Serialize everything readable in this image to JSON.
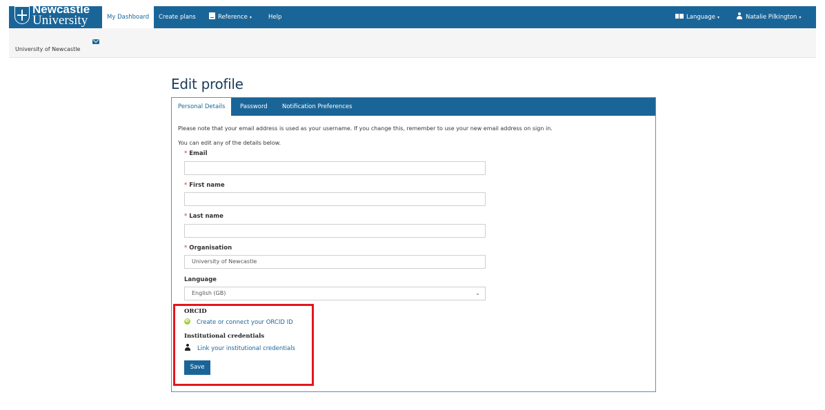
{
  "header": {
    "logo_line1": "Newcastle",
    "logo_line2": "University",
    "nav": [
      {
        "label": "My Dashboard",
        "active": true
      },
      {
        "label": "Create plans"
      },
      {
        "label": "Reference",
        "dropdown": true,
        "icon": "book-icon"
      },
      {
        "label": "Help"
      }
    ],
    "language_label": "Language",
    "user_name": "Natalie Pilkington",
    "caret": "▾"
  },
  "subbar": {
    "organisation": "University of Newcastle",
    "icon": "mail-icon"
  },
  "page": {
    "title": "Edit profile",
    "tabs": [
      {
        "label": "Personal Details",
        "active": true
      },
      {
        "label": "Password"
      },
      {
        "label": "Notification Preferences"
      }
    ],
    "notice": "Please note that your email address is used as your username. If you change this, remember to use your new email address on sign in.",
    "intro": "You can edit any of the details below.",
    "required_marker": "*",
    "fields": {
      "email": {
        "label": "Email",
        "value": ""
      },
      "first_name": {
        "label": "First name",
        "value": ""
      },
      "last_name": {
        "label": "Last name",
        "value": ""
      },
      "organisation": {
        "label": "Organisation",
        "value": "University of Newcastle"
      },
      "language": {
        "label": "Language",
        "selected": "English (GB)"
      }
    },
    "orcid": {
      "heading": "ORCID",
      "link": "Create or connect your ORCID ID"
    },
    "institutional": {
      "heading": "Institutional credentials",
      "link": "Link your institutional credentials"
    },
    "save_label": "Save",
    "select_chevron": "⌄"
  },
  "colors": {
    "brand": "#1a6598",
    "highlight": "#e5161c",
    "orcid": "#a6ce39",
    "required": "#c0392b"
  }
}
